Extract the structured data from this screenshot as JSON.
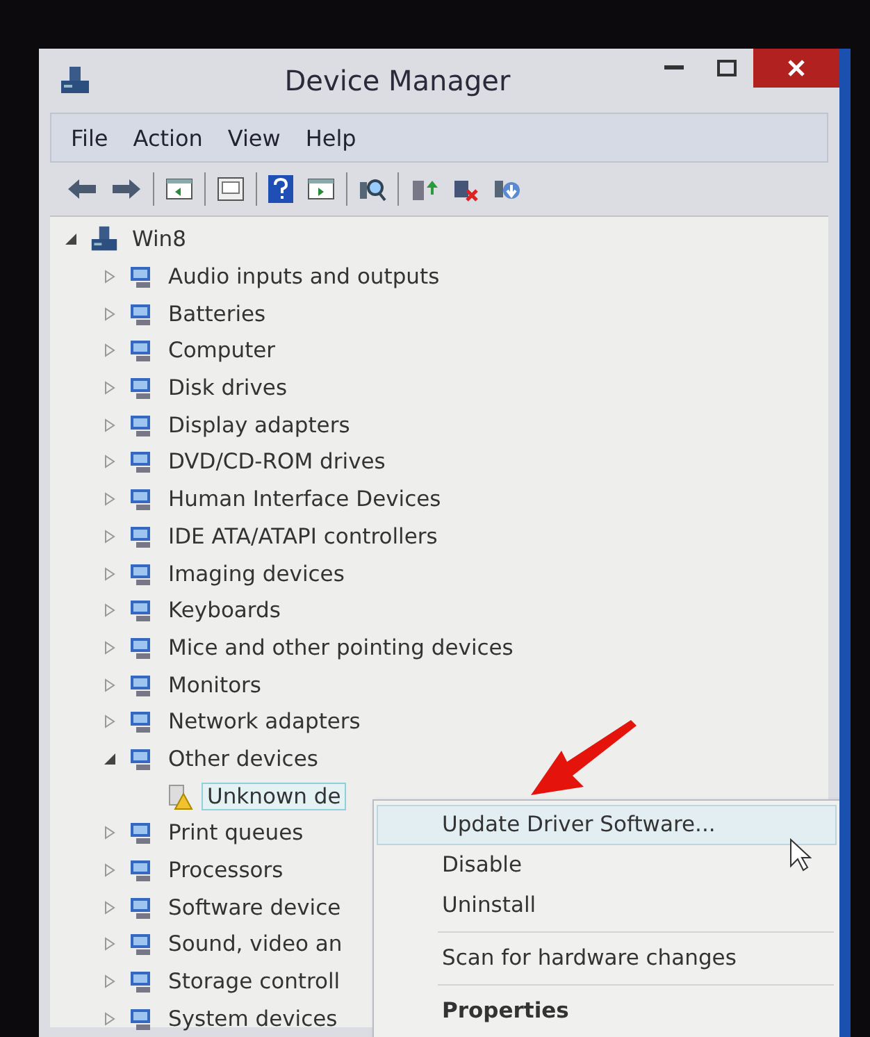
{
  "window": {
    "title": "Device Manager"
  },
  "menu_bar": [
    "File",
    "Action",
    "View",
    "Help"
  ],
  "tree": [
    {
      "label": "Win8",
      "kind": "computer",
      "expanded": true,
      "selected": false,
      "children": [
        {
          "label": "Audio inputs and outputs",
          "kind": "category",
          "expanded": false,
          "selected": false
        },
        {
          "label": "Batteries",
          "kind": "category",
          "expanded": false,
          "selected": false
        },
        {
          "label": "Computer",
          "kind": "category",
          "expanded": false,
          "selected": false
        },
        {
          "label": "Disk drives",
          "kind": "category",
          "expanded": false,
          "selected": false
        },
        {
          "label": "Display adapters",
          "kind": "category",
          "expanded": false,
          "selected": false
        },
        {
          "label": "DVD/CD-ROM drives",
          "kind": "category",
          "expanded": false,
          "selected": false
        },
        {
          "label": "Human Interface Devices",
          "kind": "category",
          "expanded": false,
          "selected": false
        },
        {
          "label": "IDE ATA/ATAPI controllers",
          "kind": "category",
          "expanded": false,
          "selected": false
        },
        {
          "label": "Imaging devices",
          "kind": "category",
          "expanded": false,
          "selected": false
        },
        {
          "label": "Keyboards",
          "kind": "category",
          "expanded": false,
          "selected": false
        },
        {
          "label": "Mice and other pointing devices",
          "kind": "category",
          "expanded": false,
          "selected": false
        },
        {
          "label": "Monitors",
          "kind": "category",
          "expanded": false,
          "selected": false
        },
        {
          "label": "Network adapters",
          "kind": "category",
          "expanded": false,
          "selected": false
        },
        {
          "label": "Other devices",
          "kind": "category",
          "expanded": true,
          "selected": false,
          "children": [
            {
              "label": "Unknown de",
              "kind": "warning-device",
              "selected": true
            }
          ]
        },
        {
          "label": "Print queues",
          "kind": "category",
          "expanded": false,
          "selected": false
        },
        {
          "label": "Processors",
          "kind": "category",
          "expanded": false,
          "selected": false
        },
        {
          "label": "Software device",
          "kind": "category",
          "expanded": false,
          "selected": false
        },
        {
          "label": "Sound, video an",
          "kind": "category",
          "expanded": false,
          "selected": false
        },
        {
          "label": "Storage controll",
          "kind": "category",
          "expanded": false,
          "selected": false
        },
        {
          "label": "System devices",
          "kind": "category",
          "expanded": false,
          "selected": false
        }
      ]
    }
  ],
  "context_menu": [
    {
      "kind": "item",
      "label": "Update Driver Software...",
      "selected": true
    },
    {
      "kind": "item",
      "label": "Disable",
      "selected": false
    },
    {
      "kind": "item",
      "label": "Uninstall",
      "selected": false
    },
    {
      "kind": "separator"
    },
    {
      "kind": "item",
      "label": "Scan for hardware changes",
      "selected": false
    },
    {
      "kind": "separator"
    },
    {
      "kind": "default",
      "label": "Properties",
      "selected": false
    }
  ]
}
